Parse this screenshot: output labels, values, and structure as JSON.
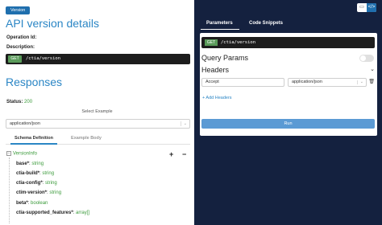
{
  "left": {
    "version_tag": "Version",
    "title": "API version details",
    "operation_id_label": "Operation Id:",
    "description_label": "Description:",
    "endpoint": {
      "method": "GET",
      "path": "/ctia/version"
    },
    "responses_title": "Responses",
    "status_label": "Status:",
    "status_value": "200",
    "select_example_label": "Select Example",
    "select_value": "application/json",
    "tabs": [
      {
        "label": "Schema Definition",
        "active": true
      },
      {
        "label": "Example Body",
        "active": false
      }
    ],
    "schema": {
      "root": "VersionInfo",
      "expand_all": "+",
      "collapse_all": "−",
      "properties": [
        {
          "name": "base*",
          "type": "string"
        },
        {
          "name": "ctia-build*",
          "type": "string"
        },
        {
          "name": "ctia-config*",
          "type": "string"
        },
        {
          "name": "ctim-version*",
          "type": "string"
        },
        {
          "name": "beta*",
          "type": "boolean"
        },
        {
          "name": "ctia-supported_features*",
          "type": "array[]"
        }
      ]
    }
  },
  "right": {
    "tabs": [
      {
        "label": "Parameters",
        "active": true
      },
      {
        "label": "Code Snippets",
        "active": false
      }
    ],
    "icons": [
      "split-view-icon",
      "code-view-icon"
    ],
    "endpoint": {
      "method": "GET",
      "path": "/ctia/version"
    },
    "query_params_label": "Query Params",
    "query_params_enabled": false,
    "headers_label": "Headers",
    "header_row": {
      "name": "Accept",
      "value": "application/json"
    },
    "add_headers_label": "+ Add Headers",
    "run_label": "Run"
  },
  "colors": {
    "accent": "#2b86c5",
    "right_pane_bg": "#14213f",
    "success": "#3a9a3a",
    "run_button": "#5b9ad4"
  }
}
